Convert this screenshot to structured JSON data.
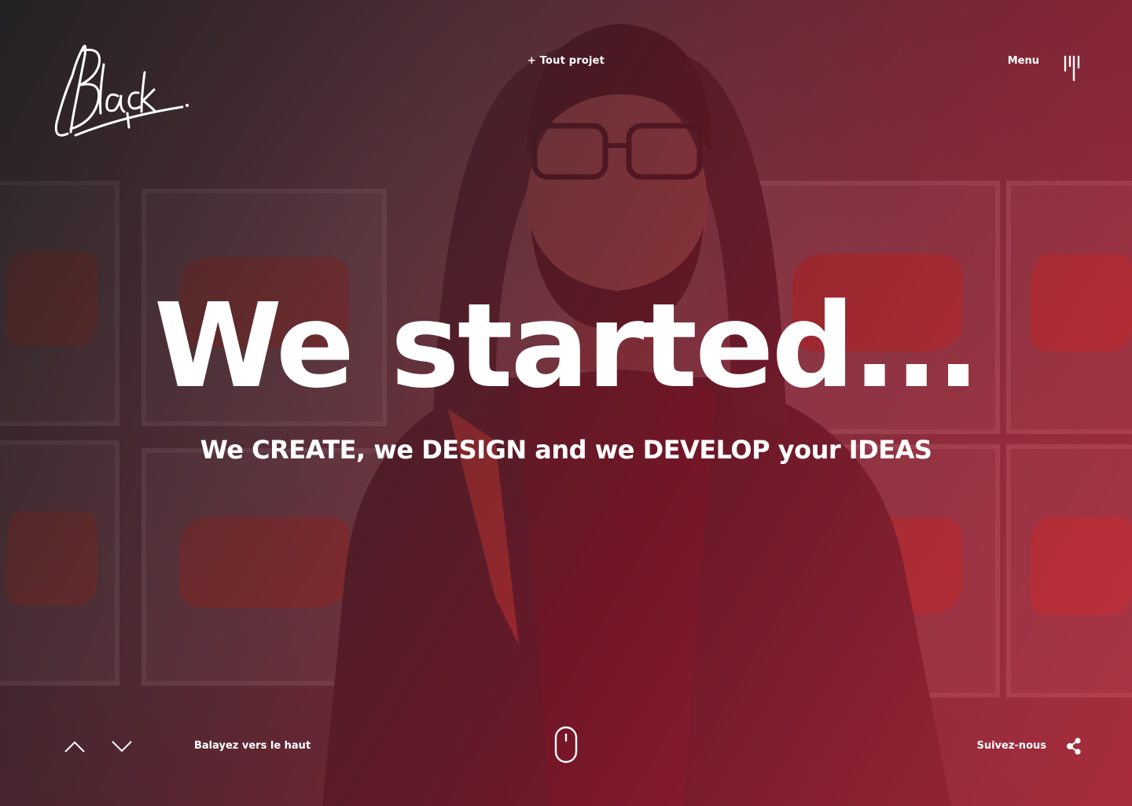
{
  "header": {
    "logo_text": "Black",
    "project_link": "+ Tout projet",
    "menu_label": "Menu"
  },
  "hero": {
    "headline": "We started...",
    "subline": "We CREATE, we DESIGN and we DEVELOP your IDEAS"
  },
  "footer": {
    "swipe_label": "Balayez vers le haut",
    "follow_label": "Suivez-nous"
  },
  "icons": {
    "menu": "menu-lines-icon",
    "arrow_up": "chevron-up-icon",
    "arrow_down": "chevron-down-icon",
    "mouse": "mouse-scroll-icon",
    "share": "share-icon"
  },
  "colors": {
    "overlay_start": "#1c1c1e",
    "overlay_end": "#be283c",
    "accent_orange": "#e0563a",
    "text": "#ffffff"
  }
}
